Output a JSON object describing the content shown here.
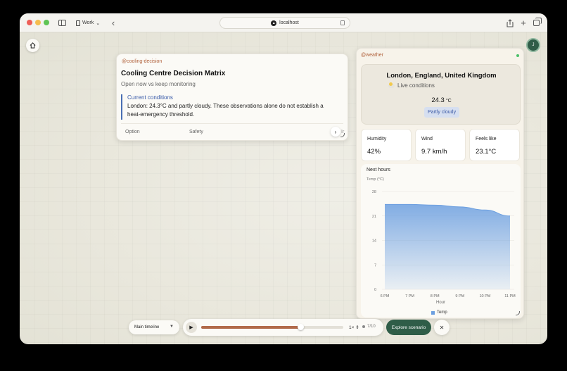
{
  "browser": {
    "workspace_label": "Work",
    "url": "localhost"
  },
  "avatar_initial": "J",
  "cooling_card": {
    "tag": "@cooling-decision",
    "title": "Cooling Centre Decision Matrix",
    "subtitle": "Open now vs keep monitoring",
    "conditions_title": "Current conditions",
    "conditions_text": "London: 24.3°C and partly cloudy. These observations alone do not establish a heat-emergency threshold.",
    "columns": [
      "Option",
      "Safety"
    ],
    "clipped_column": "Ir"
  },
  "weather_card": {
    "tag": "@weather",
    "location": "London, England, United Kingdom",
    "live_label": "Live conditions",
    "temperature": "24.3",
    "temperature_unit": "°C",
    "condition": "Partly cloudy",
    "stats": [
      {
        "label": "Humidity",
        "value": "42%"
      },
      {
        "label": "Wind",
        "value": "9.7 km/h"
      },
      {
        "label": "Feels like",
        "value": "23.1°C"
      }
    ],
    "chart_title": "Next hours"
  },
  "chart_data": {
    "type": "area",
    "title": "Next hours",
    "xlabel": "Hour",
    "ylabel": "Temp (°C)",
    "categories": [
      "6 PM",
      "7 PM",
      "8 PM",
      "9 PM",
      "10 PM",
      "11 PM"
    ],
    "series": [
      {
        "name": "Temp",
        "values": [
          24.3,
          24.3,
          24.1,
          23.6,
          22.7,
          21.0
        ],
        "color": "#6c9fe0"
      }
    ],
    "yticks": [
      0,
      7,
      14,
      21,
      28
    ],
    "ylim": [
      0,
      28
    ],
    "grid": true,
    "legend": "bottom"
  },
  "timeline": {
    "select_label": "Main timeline",
    "progress": 0.7,
    "speed": "1×",
    "step": "7/10",
    "explore_label": "Explore scenario"
  }
}
